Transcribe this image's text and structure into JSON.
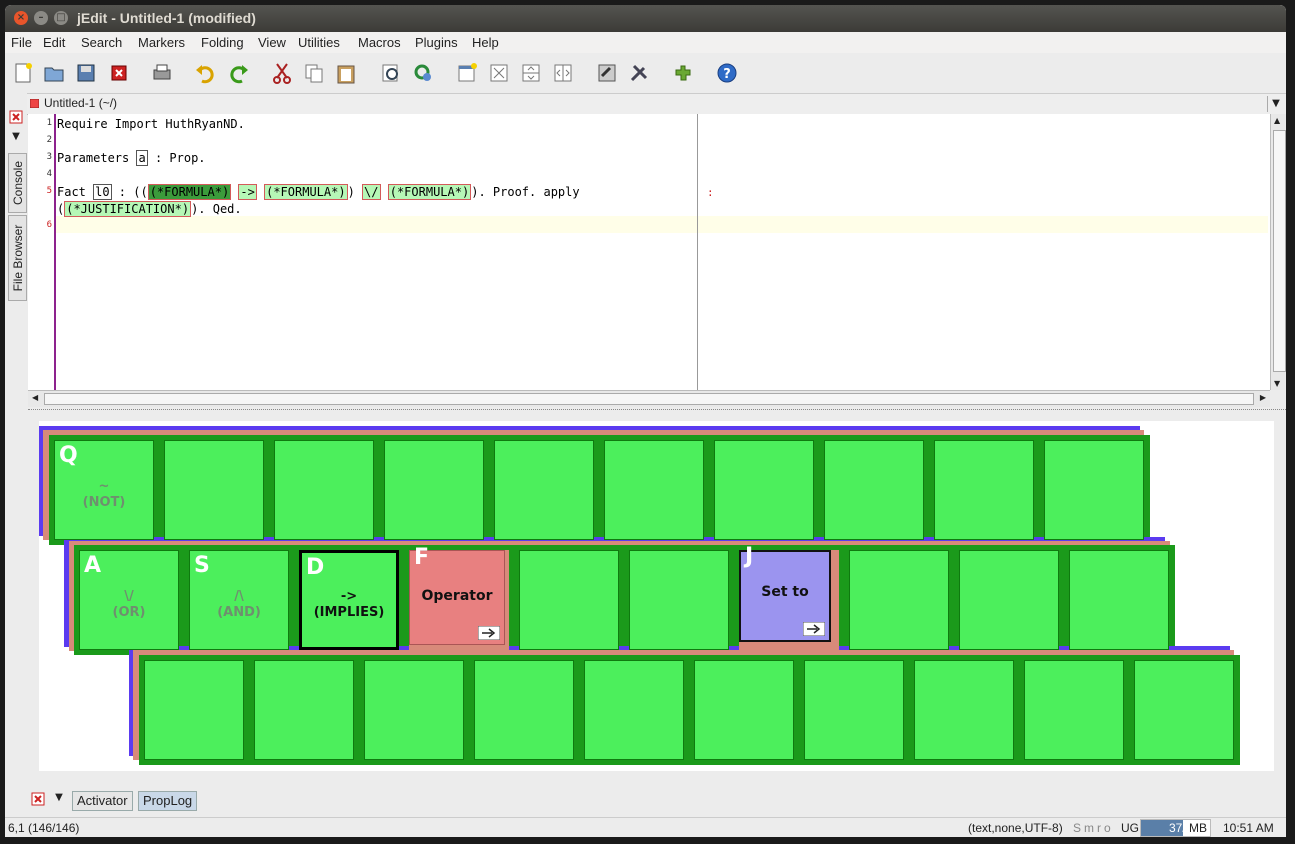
{
  "window": {
    "title": "jEdit - Untitled-1 (modified)"
  },
  "menu": [
    "File",
    "Edit",
    "Search",
    "Markers",
    "Folding",
    "View",
    "Utilities",
    "Macros",
    "Plugins",
    "Help"
  ],
  "buffer": {
    "title": "Untitled-1 (~/)"
  },
  "side_tabs": [
    "Console",
    "File Browser"
  ],
  "editor": {
    "line_numbers": [
      "1",
      "2",
      "3",
      "4",
      "5",
      "",
      "6"
    ],
    "line1": "Require Import HuthRyanND.",
    "line3_a": "Parameters ",
    "line3_b": "a",
    "line3_c": " : Prop.",
    "line5_a": "Fact ",
    "line5_b": "l0",
    "line5_c": " : ((",
    "line5_d": "(*FORMULA*)",
    "line5_e": " ",
    "line5_f": "->",
    "line5_g": " ",
    "line5_h": "(*FORMULA*)",
    "line5_i": ") ",
    "line5_j": "\\/",
    "line5_k": " ",
    "line5_l": "(*FORMULA*)",
    "line5_m": "). Proof. apply",
    "line5b_a": "(",
    "line5b_b": "(*JUSTIFICATION*)",
    "line5b_c": "). Qed.",
    "marker": ":"
  },
  "keyboard": {
    "row1": [
      {
        "letter": "Q",
        "label": "~\n(NOT)"
      },
      {
        "letter": "",
        "label": ""
      },
      {
        "letter": "",
        "label": ""
      },
      {
        "letter": "",
        "label": ""
      },
      {
        "letter": "",
        "label": ""
      },
      {
        "letter": "",
        "label": ""
      },
      {
        "letter": "",
        "label": ""
      },
      {
        "letter": "",
        "label": ""
      },
      {
        "letter": "",
        "label": ""
      },
      {
        "letter": "",
        "label": ""
      }
    ],
    "row2": [
      {
        "letter": "A",
        "label": "\\/\n(OR)"
      },
      {
        "letter": "S",
        "label": "/\\\n(AND)"
      },
      {
        "letter": "D",
        "label": "->\n(IMPLIES)"
      },
      {
        "letter": "F",
        "label": "Operator"
      },
      {
        "letter": "",
        "label": ""
      },
      {
        "letter": "",
        "label": ""
      },
      {
        "letter": "J",
        "label": "Set to"
      },
      {
        "letter": "",
        "label": ""
      },
      {
        "letter": "",
        "label": ""
      },
      {
        "letter": "",
        "label": ""
      }
    ],
    "row3": [
      {
        "letter": "",
        "label": ""
      },
      {
        "letter": "",
        "label": ""
      },
      {
        "letter": "",
        "label": ""
      },
      {
        "letter": "",
        "label": ""
      },
      {
        "letter": "",
        "label": ""
      },
      {
        "letter": "",
        "label": ""
      },
      {
        "letter": "",
        "label": ""
      },
      {
        "letter": "",
        "label": ""
      },
      {
        "letter": "",
        "label": ""
      },
      {
        "letter": "",
        "label": ""
      }
    ],
    "colors": {
      "key": "#4cef5c",
      "row": "#1b9a1b",
      "operator": "#e88080",
      "setto": "#9b94ef",
      "shadow_blue": "#5b3bf0",
      "shadow_red": "#d88a7a"
    }
  },
  "bottom_tabs": [
    "Activator",
    "PropLog"
  ],
  "status": {
    "position": "6,1 (146/146)",
    "mode": "(text,none,UTF-8)",
    "flags": "Smro",
    "flags2": "UG",
    "memory": "37/60",
    "memory_unit": "MB",
    "time": "10:51 AM"
  }
}
